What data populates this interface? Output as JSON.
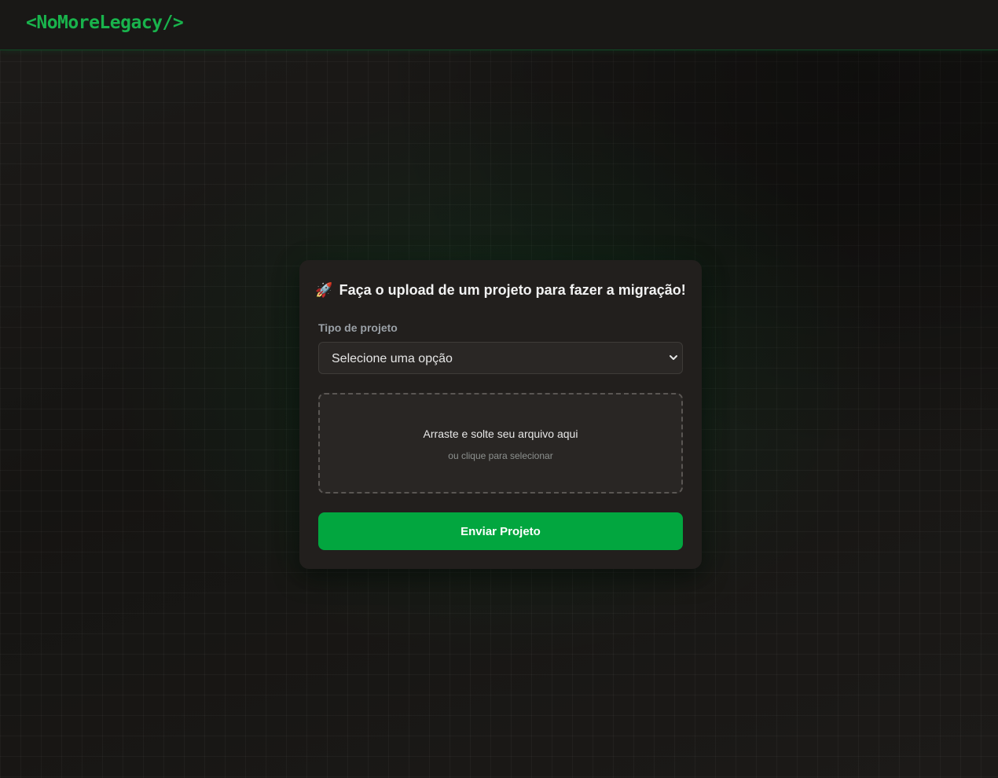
{
  "header": {
    "logo": "<NoMoreLegacy/>"
  },
  "upload_card": {
    "title_icon": "🚀",
    "title": "Faça o upload de um projeto para fazer a migração!",
    "project_type_label": "Tipo de projeto",
    "project_type_selected": "Selecione uma opção",
    "dropzone_primary": "Arraste e solte seu arquivo aqui",
    "dropzone_secondary": "ou clique para selecionar",
    "submit_label": "Enviar Projeto"
  },
  "icons": {
    "title": "rocket-icon",
    "select": "chevron-down-icon"
  },
  "colors": {
    "accent": "#02a63f",
    "logo": "#19b34c",
    "background": "#1a1816",
    "card": "#221f1d"
  }
}
